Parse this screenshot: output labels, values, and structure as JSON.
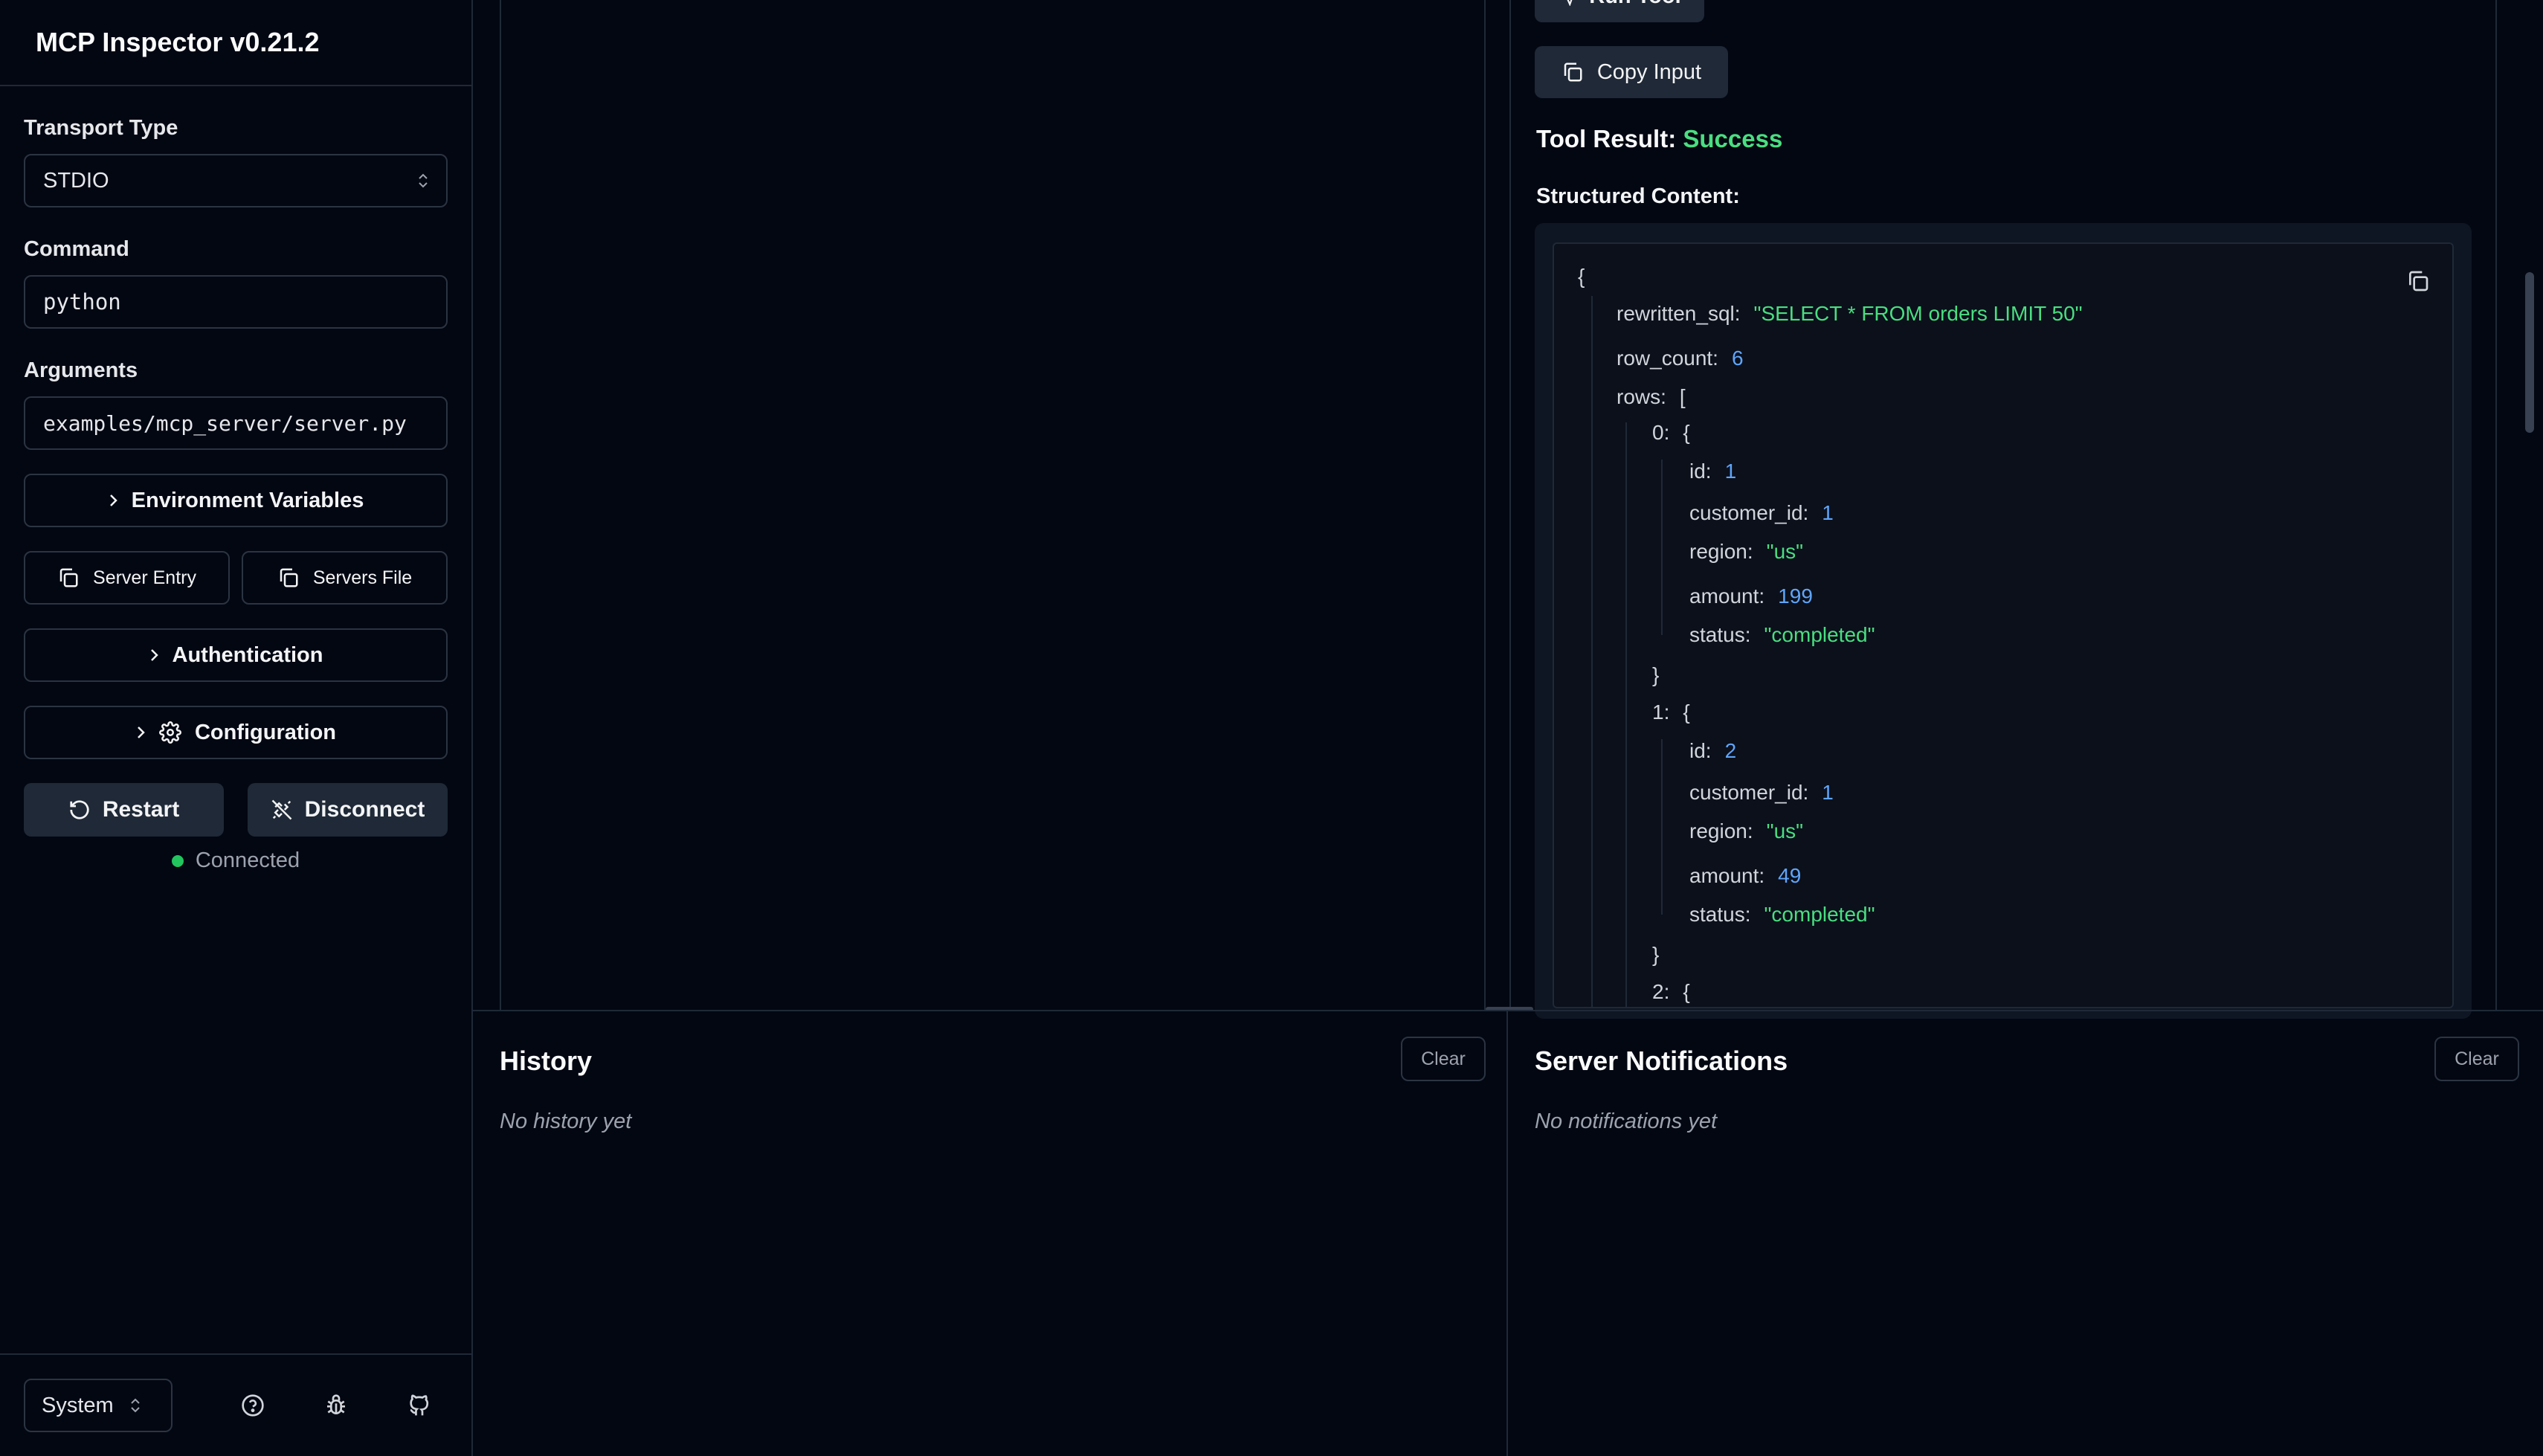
{
  "app": {
    "title": "MCP Inspector v0.21.2"
  },
  "sidebar": {
    "transport_label": "Transport Type",
    "transport_value": "STDIO",
    "command_label": "Command",
    "command_value": "python",
    "arguments_label": "Arguments",
    "arguments_value": "examples/mcp_server/server.py",
    "env_vars_label": "Environment Variables",
    "server_entry_label": "Server Entry",
    "servers_file_label": "Servers File",
    "authentication_label": "Authentication",
    "configuration_label": "Configuration",
    "restart_label": "Restart",
    "disconnect_label": "Disconnect",
    "status_text": "Connected",
    "status_color": "#22c55e",
    "theme_value": "System"
  },
  "tool": {
    "run_tool_label": "Run Tool",
    "copy_input_label": "Copy Input",
    "result_label": "Tool Result:",
    "result_status": "Success",
    "structured_label": "Structured Content:",
    "json": {
      "open_brace": "{",
      "rewritten_sql_key": "rewritten_sql:",
      "rewritten_sql_value": "\"SELECT * FROM orders LIMIT 50\"",
      "row_count_key": "row_count:",
      "row_count_value": "6",
      "rows_key": "rows:",
      "rows_open": "[",
      "rows": [
        {
          "index_key": "0:",
          "open": "{",
          "id": "1",
          "customer_id": "1",
          "region": "\"us\"",
          "amount": "199",
          "status": "\"completed\"",
          "close": "}"
        },
        {
          "index_key": "1:",
          "open": "{",
          "id": "2",
          "customer_id": "1",
          "region": "\"us\"",
          "amount": "49",
          "status": "\"completed\"",
          "close": "}"
        },
        {
          "index_key": "2:",
          "open": "{"
        }
      ],
      "id_key": "id:",
      "customer_id_key": "customer_id:",
      "region_key": "region:",
      "amount_key": "amount:",
      "status_key": "status:"
    }
  },
  "history": {
    "title": "History",
    "empty_text": "No history yet",
    "clear_label": "Clear"
  },
  "notifications": {
    "title": "Server Notifications",
    "empty_text": "No notifications yet",
    "clear_label": "Clear"
  },
  "colors": {
    "success": "#4ade80",
    "json_string": "#4ade80",
    "json_number": "#60a5fa",
    "background": "#030712"
  }
}
